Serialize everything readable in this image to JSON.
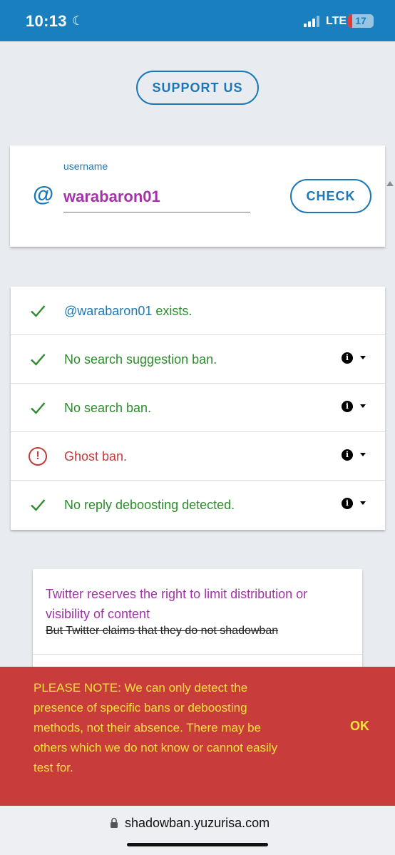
{
  "status_bar": {
    "time": "10:13",
    "moon_icon": "moon-icon",
    "network": "LTE",
    "battery_level": "17",
    "battery_fraction": 0.17
  },
  "support_button": {
    "label": "SUPPORT US"
  },
  "search": {
    "field_label": "username",
    "value": "warabaron01",
    "at_symbol": "@",
    "check_label": "CHECK"
  },
  "results": [
    {
      "status": "ok",
      "prefix": "@warabaron01",
      "text": " exists.",
      "has_info": false
    },
    {
      "status": "ok",
      "text": "No search suggestion ban.",
      "has_info": true
    },
    {
      "status": "ok",
      "text": "No search ban.",
      "has_info": true
    },
    {
      "status": "bad",
      "text": "Ghost ban.",
      "has_info": true
    },
    {
      "status": "ok",
      "text": "No reply deboosting detected.",
      "has_info": true
    }
  ],
  "notice": {
    "title": "Twitter reserves the right to limit distribution or visibility of content",
    "strikethrough": "But Twitter claims that they do not shadowban"
  },
  "banner": {
    "text": "PLEASE NOTE: We can only detect the presence of specific bans or deboosting methods, not their absence. There may be others which we do not know or cannot easily test for.",
    "ok_label": "OK"
  },
  "address_bar": {
    "url": "shadowban.yuzurisa.com"
  },
  "colors": {
    "status_bar": "#1a7fbf",
    "accent_blue": "#1b78b8",
    "username_purple": "#a233a8",
    "ok_green": "#2e8b2e",
    "error_red": "#c43a3a",
    "banner_red": "#c83c3c",
    "banner_text": "#f5e33c"
  }
}
